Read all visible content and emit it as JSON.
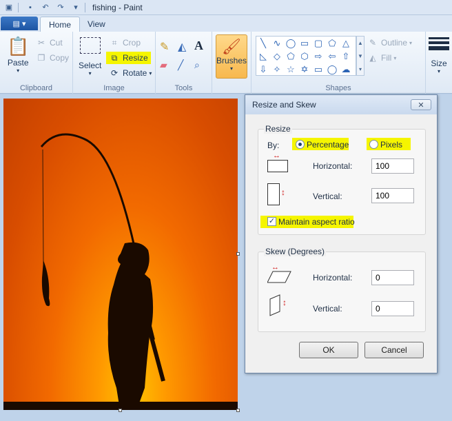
{
  "window": {
    "title": "fishing - Paint"
  },
  "tabs": {
    "home": "Home",
    "view": "View"
  },
  "clipboard": {
    "paste": "Paste",
    "cut": "Cut",
    "copy": "Copy",
    "group": "Clipboard"
  },
  "image": {
    "select": "Select",
    "crop": "Crop",
    "resize": "Resize",
    "rotate": "Rotate",
    "group": "Image"
  },
  "tools": {
    "group": "Tools"
  },
  "brushes": {
    "label": "Brushes"
  },
  "shapes": {
    "outline": "Outline",
    "fill": "Fill",
    "group": "Shapes"
  },
  "size": {
    "label": "Size"
  },
  "dialog": {
    "title": "Resize and Skew",
    "resize_label": "Resize",
    "by_label": "By:",
    "percentage": "Percentage",
    "pixels": "Pixels",
    "horizontal_label": "Horizontal:",
    "horizontal_value": "100",
    "vertical_label": "Vertical:",
    "vertical_value": "100",
    "maintain": "Maintain aspect ratio",
    "skew_label": "Skew (Degrees)",
    "skew_horizontal_label": "Horizontal:",
    "skew_horizontal_value": "0",
    "skew_vertical_label": "Vertical:",
    "skew_vertical_value": "0",
    "ok": "OK",
    "cancel": "Cancel",
    "selected_unit": "Percentage",
    "maintain_checked": true
  },
  "colors": {
    "highlight": "#f5f500",
    "ribbon_bg": "#f5f9fd",
    "accent": "#1d55a3"
  }
}
